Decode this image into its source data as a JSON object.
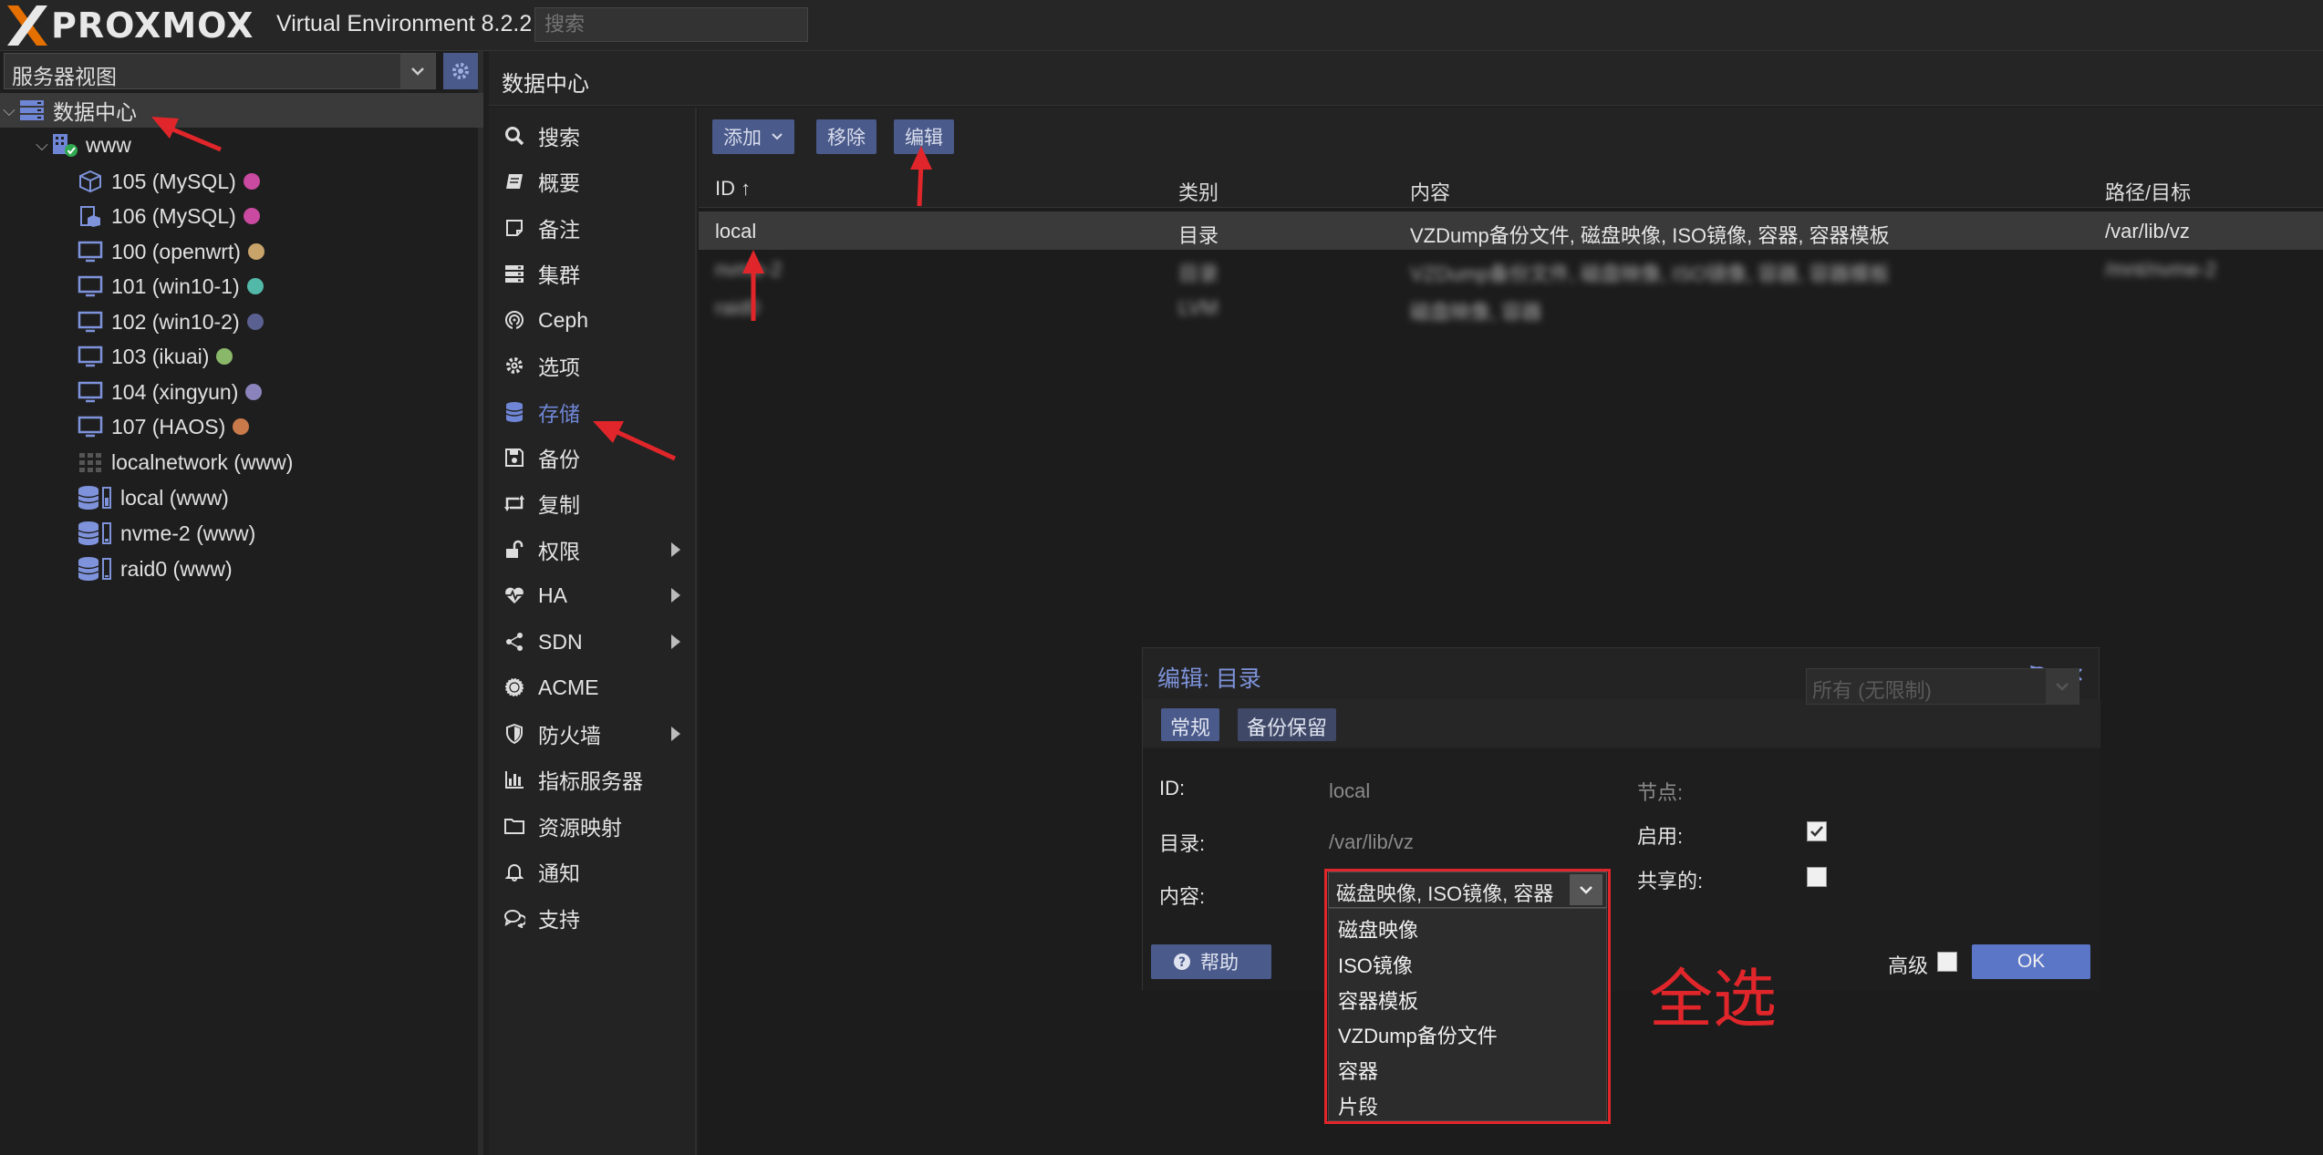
{
  "app": {
    "logo_text": "PROXMOX",
    "version": "Virtual Environment 8.2.2"
  },
  "search": {
    "placeholder": "搜索"
  },
  "view_select": {
    "value": "服务器视图"
  },
  "tree": {
    "datacenter": "数据中心",
    "node": "www",
    "items": [
      {
        "label": "105 (MySQL)",
        "dot": "#c94aa0",
        "icon": "container-icon"
      },
      {
        "label": "106 (MySQL)",
        "dot": "#c94aa0",
        "icon": "container-template-icon"
      },
      {
        "label": "100 (openwrt)",
        "dot": "#c8a46a",
        "icon": "vm-icon"
      },
      {
        "label": "101 (win10-1)",
        "dot": "#52b8a8",
        "icon": "vm-icon"
      },
      {
        "label": "102 (win10-2)",
        "dot": "#5a6090",
        "icon": "vm-icon"
      },
      {
        "label": "103 (ikuai)",
        "dot": "#8ab86a",
        "icon": "vm-icon"
      },
      {
        "label": "104 (xingyun)",
        "dot": "#8a84bc",
        "icon": "vm-icon"
      },
      {
        "label": "107 (HAOS)",
        "dot": "#c87a4a",
        "icon": "vm-icon"
      },
      {
        "label": "localnetwork (www)",
        "dot": "",
        "icon": "network-grid-icon"
      },
      {
        "label": "local (www)",
        "dot": "",
        "icon": "storage-icon"
      },
      {
        "label": "nvme-2 (www)",
        "dot": "",
        "icon": "storage-icon"
      },
      {
        "label": "raid0 (www)",
        "dot": "",
        "icon": "storage-icon"
      }
    ]
  },
  "content_header": "数据中心",
  "menu": {
    "items": [
      {
        "label": "搜索",
        "icon": "search-icon"
      },
      {
        "label": "概要",
        "icon": "book-icon"
      },
      {
        "label": "备注",
        "icon": "note-icon"
      },
      {
        "label": "集群",
        "icon": "server-icon"
      },
      {
        "label": "Ceph",
        "icon": "ceph-icon"
      },
      {
        "label": "选项",
        "icon": "gear-icon"
      },
      {
        "label": "存储",
        "icon": "database-icon",
        "active": true
      },
      {
        "label": "备份",
        "icon": "floppy-icon"
      },
      {
        "label": "复制",
        "icon": "retweet-icon"
      },
      {
        "label": "权限",
        "icon": "unlock-icon",
        "submenu": true
      },
      {
        "label": "HA",
        "icon": "heartbeat-icon",
        "submenu": true
      },
      {
        "label": "SDN",
        "icon": "sdn-icon",
        "submenu": true
      },
      {
        "label": "ACME",
        "icon": "certificate-icon"
      },
      {
        "label": "防火墙",
        "icon": "shield-icon",
        "submenu": true
      },
      {
        "label": "指标服务器",
        "icon": "bar-chart-icon"
      },
      {
        "label": "资源映射",
        "icon": "folder-icon"
      },
      {
        "label": "通知",
        "icon": "bell-icon"
      },
      {
        "label": "支持",
        "icon": "comments-icon"
      }
    ]
  },
  "toolbar": {
    "add": "添加",
    "remove": "移除",
    "edit": "编辑"
  },
  "grid": {
    "columns": [
      "ID ↑",
      "类别",
      "内容",
      "路径/目标"
    ],
    "rows": [
      {
        "id": "local",
        "type": "目录",
        "content": "VZDump备份文件, 磁盘映像, ISO镜像, 容器, 容器模板",
        "path": "/var/lib/vz",
        "blurred": false
      },
      {
        "id": "nvme-2",
        "type": "目录",
        "content": "VZDump备份文件, 磁盘映像, ISO镜像, 容器, 容器模板",
        "path": "/mnt/nvme-2",
        "blurred": true
      },
      {
        "id": "raid0",
        "type": "LVM",
        "content": "磁盘映像, 容器",
        "path": "",
        "blurred": true
      }
    ]
  },
  "dialog": {
    "title": "编辑: 目录",
    "tabs": [
      "常规",
      "备份保留"
    ],
    "fields": {
      "id_label": "ID:",
      "id_value": "local",
      "dir_label": "目录:",
      "dir_value": "/var/lib/vz",
      "content_label": "内容:",
      "content_value": "磁盘映像, ISO镜像, 容器",
      "node_label": "节点:",
      "node_value": "所有 (无限制)",
      "enable_label": "启用:",
      "shared_label": "共享的:"
    },
    "help": "帮助",
    "advanced": "高级",
    "ok": "OK",
    "dropdown_options": [
      "磁盘映像",
      "ISO镜像",
      "容器模板",
      "VZDump备份文件",
      "容器",
      "片段"
    ]
  },
  "annotation": {
    "text": "全选",
    "color": "#e0262a"
  },
  "colors": {
    "accent": "#4a5a8a",
    "accent_text": "#6f86d6",
    "annotation": "#e0262a",
    "logo_orange": "#e57000"
  }
}
